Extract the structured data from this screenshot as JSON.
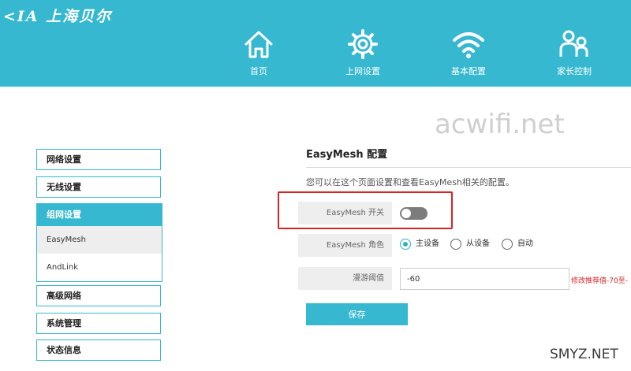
{
  "header": {
    "logo_text": "<IA 上海贝尔",
    "nav": [
      {
        "label": "首页",
        "icon": "home-icon"
      },
      {
        "label": "上网设置",
        "icon": "gear-icon"
      },
      {
        "label": "基本配置",
        "icon": "wifi-icon"
      },
      {
        "label": "家长控制",
        "icon": "users-icon"
      }
    ]
  },
  "watermarks": {
    "acwifi": "acwifi.net",
    "smyz": "SMYZ.NET"
  },
  "sidebar": {
    "items": [
      {
        "label": "网络设置"
      },
      {
        "label": "无线设置"
      },
      {
        "label": "组网设置",
        "active": true
      },
      {
        "label": "高级网络"
      },
      {
        "label": "系统管理"
      },
      {
        "label": "状态信息"
      }
    ],
    "group_subitems": [
      {
        "label": "EasyMesh",
        "active": true
      },
      {
        "label": "AndLink"
      }
    ]
  },
  "main": {
    "title": "EasyMesh 配置",
    "description": "您可以在这个页面设置和查看EasyMesh相关的配置。",
    "switch_label": "EasyMesh 开关",
    "switch_state": "off",
    "role_label": "EasyMesh 角色",
    "roles": [
      "主设备",
      "从设备",
      "自动"
    ],
    "role_selected": "主设备",
    "roaming_label": "漫游阈值",
    "roaming_value": "-60",
    "roaming_hint": "修改推荐值-70至-",
    "save_label": "保存"
  },
  "colors": {
    "brand": "#35b8d0",
    "highlight": "#d92323",
    "toggle_off": "#7c7c7c"
  }
}
